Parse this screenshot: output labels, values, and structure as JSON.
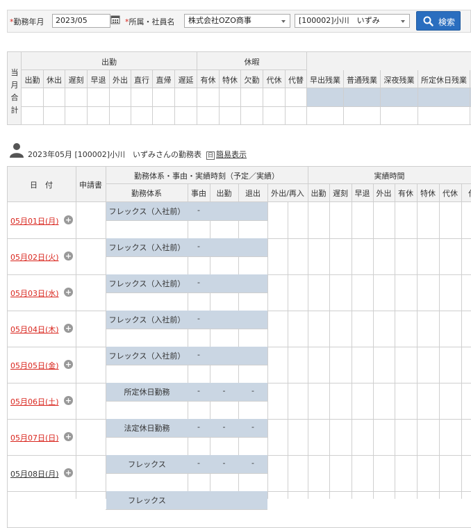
{
  "filter": {
    "month_label": "勤務年月",
    "month_value": "2023/05",
    "org_label": "所属・社員名",
    "company": "株式会社OZO商事",
    "employee": "[100002]小川　いずみ",
    "search_label": "検索",
    "required_mark": "*"
  },
  "summary": {
    "row_header_chars": [
      "当",
      "月",
      "合",
      "計"
    ],
    "group_attendance": "出勤",
    "group_leave": "休暇",
    "attendance_cols": [
      "出勤",
      "休出",
      "遅刻",
      "早退",
      "外出",
      "直行",
      "直帰",
      "遅延"
    ],
    "leave_cols": [
      "有休",
      "特休",
      "欠勤",
      "代休",
      "代替"
    ],
    "overtime_cols": [
      "早出残業",
      "普通残業",
      "深夜残業",
      "所定休日残業"
    ]
  },
  "section": {
    "title": "2023年05月 [100002]小川　いずみさんの勤務表",
    "simple_view_label": "簡易表示",
    "simple_view_prefix": "日"
  },
  "table": {
    "date_header": "日　付",
    "application_header": "申請書",
    "group_work": "勤務体系・事由・実績時刻（予定／実績）",
    "group_actual": "実績時間",
    "work_cols": [
      "勤務体系",
      "事由",
      "出勤",
      "退出",
      "外出/再入"
    ],
    "actual_cols": [
      "出勤",
      "遅刻",
      "早退",
      "外出",
      "有休",
      "特休",
      "代休",
      "代"
    ],
    "rows": [
      {
        "date": "05月01日(月)",
        "work_type": "フレックス（入社前）",
        "reason": "-",
        "in": "",
        "out": "",
        "holiday": true
      },
      {
        "date": "05月02日(火)",
        "work_type": "フレックス（入社前）",
        "reason": "-",
        "in": "",
        "out": "",
        "holiday": true
      },
      {
        "date": "05月03日(水)",
        "work_type": "フレックス（入社前）",
        "reason": "-",
        "in": "",
        "out": "",
        "holiday": true
      },
      {
        "date": "05月04日(木)",
        "work_type": "フレックス（入社前）",
        "reason": "-",
        "in": "",
        "out": "",
        "holiday": true
      },
      {
        "date": "05月05日(金)",
        "work_type": "フレックス（入社前）",
        "reason": "-",
        "in": "",
        "out": "",
        "holiday": true
      },
      {
        "date": "05月06日(土)",
        "work_type": "所定休日勤務",
        "reason": "-",
        "in": "-",
        "out": "-",
        "holiday": true
      },
      {
        "date": "05月07日(日)",
        "work_type": "法定休日勤務",
        "reason": "-",
        "in": "-",
        "out": "-",
        "holiday": true
      },
      {
        "date": "05月08日(月)",
        "work_type": "フレックス",
        "reason": "-",
        "in": "-",
        "out": "-",
        "holiday": false
      },
      {
        "date": "",
        "work_type": "フレックス",
        "reason": "",
        "in": "",
        "out": "",
        "holiday": false
      }
    ]
  }
}
